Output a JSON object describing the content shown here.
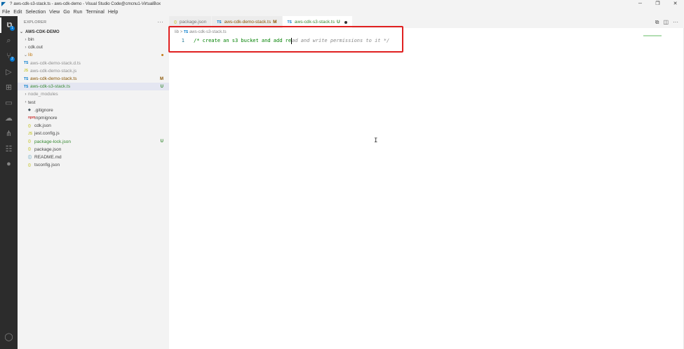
{
  "window": {
    "title": "aws-cdk-s3-stack.ts - aws-cdk-demo - Visual Studio Code@cmcnu1-VirtualBox",
    "title_prefix": "?",
    "app_icon": "vscode-icon",
    "controls": [
      "─",
      "❐",
      "✕"
    ]
  },
  "menu": {
    "items": [
      "File",
      "Edit",
      "Selection",
      "View",
      "Go",
      "Run",
      "Terminal",
      "Help"
    ]
  },
  "activity_bar": {
    "items": [
      {
        "name": "explorer-icon",
        "glyph": "⧉",
        "active": true,
        "badge": "1"
      },
      {
        "name": "search-icon",
        "glyph": "⌕",
        "active": false
      },
      {
        "name": "source-control-icon",
        "glyph": "⑂",
        "active": false,
        "badge": "2"
      },
      {
        "name": "run-debug-icon",
        "glyph": "▷",
        "active": false
      },
      {
        "name": "extensions-icon",
        "glyph": "⊞",
        "active": false
      },
      {
        "name": "remote-explorer-icon",
        "glyph": "▭",
        "active": false
      },
      {
        "name": "docker-icon",
        "glyph": "☁",
        "active": false
      },
      {
        "name": "aws-icon",
        "glyph": "⋔",
        "active": false
      },
      {
        "name": "database-icon",
        "glyph": "☷",
        "active": false
      },
      {
        "name": "mongodb-leaf-icon",
        "glyph": "●",
        "active": false
      },
      {
        "name": "account-icon",
        "glyph": "◯",
        "active": false
      }
    ]
  },
  "explorer": {
    "header": "EXPLORER",
    "more_glyph": "···",
    "root": "AWS-CDK-DEMO",
    "items": [
      {
        "label": "bin",
        "indent": 1,
        "chev": "›",
        "icon": "",
        "style": "normal",
        "status": ""
      },
      {
        "label": "cdk.out",
        "indent": 1,
        "chev": "›",
        "icon": "",
        "style": "normal",
        "status": ""
      },
      {
        "label": "lib",
        "indent": 1,
        "chev": "⌄",
        "icon": "",
        "style": "orange",
        "status": "",
        "dot": true
      },
      {
        "label": "aws-cdk-demo-stack.d.ts",
        "indent": 2,
        "chev": "",
        "icon": "TS",
        "iconclass": "ico-ts",
        "style": "dim",
        "status": ""
      },
      {
        "label": "aws-cdk-demo-stack.js",
        "indent": 2,
        "chev": "",
        "icon": "JS",
        "iconclass": "ico-js",
        "style": "dim",
        "status": ""
      },
      {
        "label": "aws-cdk-demo-stack.ts",
        "indent": 2,
        "chev": "",
        "icon": "TS",
        "iconclass": "ico-ts",
        "style": "mod",
        "status": "M"
      },
      {
        "label": "aws-cdk-s3-stack.ts",
        "indent": 2,
        "chev": "",
        "icon": "TS",
        "iconclass": "ico-ts",
        "style": "untracked",
        "status": "U",
        "selected": true
      },
      {
        "label": "node_modules",
        "indent": 1,
        "chev": "›",
        "icon": "",
        "style": "dim",
        "status": ""
      },
      {
        "label": "test",
        "indent": 1,
        "chev": "›",
        "icon": "",
        "style": "normal",
        "status": ""
      },
      {
        "label": ".gitignore",
        "indent": 1,
        "chev": "",
        "icon": "◆",
        "iconclass": "ico-git",
        "style": "normal",
        "status": ""
      },
      {
        "label": ".npmignore",
        "indent": 1,
        "chev": "",
        "icon": "npm",
        "iconclass": "ico-npm",
        "style": "normal",
        "status": ""
      },
      {
        "label": "cdk.json",
        "indent": 1,
        "chev": "",
        "icon": "{}",
        "iconclass": "ico-json",
        "style": "normal",
        "status": ""
      },
      {
        "label": "jest.config.js",
        "indent": 1,
        "chev": "",
        "icon": "JS",
        "iconclass": "ico-js",
        "style": "normal",
        "status": ""
      },
      {
        "label": "package-lock.json",
        "indent": 1,
        "chev": "",
        "icon": "{}",
        "iconclass": "ico-json",
        "style": "untracked",
        "status": "U"
      },
      {
        "label": "package.json",
        "indent": 1,
        "chev": "",
        "icon": "{}",
        "iconclass": "ico-json",
        "style": "normal",
        "status": ""
      },
      {
        "label": "README.md",
        "indent": 1,
        "chev": "",
        "icon": "ⓘ",
        "iconclass": "ico-info",
        "style": "normal",
        "status": ""
      },
      {
        "label": "tsconfig.json",
        "indent": 1,
        "chev": "",
        "icon": "{}",
        "iconclass": "ico-json",
        "style": "normal",
        "status": ""
      }
    ]
  },
  "tabs": [
    {
      "label": "package.json",
      "icon": "{}",
      "iconclass": "ico-json",
      "active": false,
      "status": ""
    },
    {
      "label": "aws-cdk-demo-stack.ts",
      "icon": "TS",
      "iconclass": "ico-ts",
      "active": false,
      "status": "M"
    },
    {
      "label": "aws-cdk-s3-stack.ts",
      "icon": "TS",
      "iconclass": "ico-ts",
      "active": true,
      "status": "U",
      "dirty": true
    }
  ],
  "editor_actions": [
    "⧉",
    "◫",
    "···"
  ],
  "editor": {
    "breadcrumb": {
      "folder": "lib",
      "sep": ">",
      "file_icon": "TS",
      "file": "aws-cdk-s3-stack.ts"
    },
    "line_number": "1",
    "code_before_cursor": "/* create an s3 bucket and add re",
    "ghost_suggestion": "ad and write permissions to it */"
  },
  "colors": {
    "annotation_box": "#e02020",
    "comment": "#008000",
    "modified": "#895503",
    "untracked": "#388a34"
  }
}
